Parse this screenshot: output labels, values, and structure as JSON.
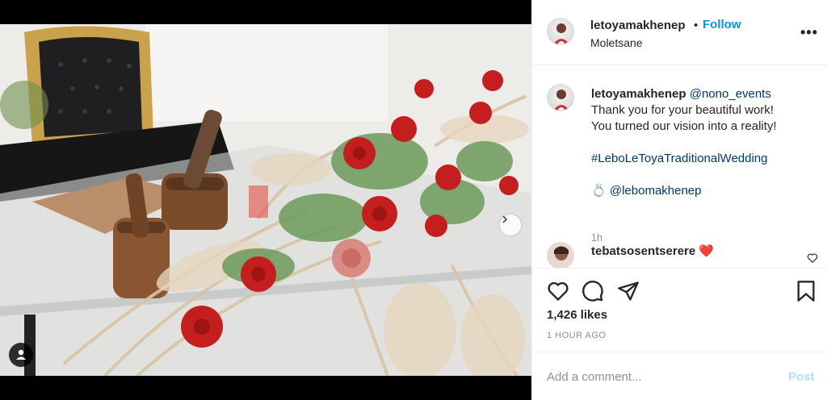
{
  "post": {
    "username": "letoyamakhenep",
    "follow_label": "Follow",
    "separator": "•",
    "location": "Moletsane",
    "more_label": "•••"
  },
  "caption": {
    "username": "letoyamakhenep",
    "mention": "@nono_events",
    "line1": "Thank you for your beautiful work!",
    "line2": "You turned our vision into a reality!",
    "hashtag": "#LeboLeToyaTraditionalWedding",
    "ring_emoji": "💍",
    "tag_user": "@lebomakhenep",
    "time": "1h"
  },
  "comment": {
    "username": "tebatsosentserere",
    "emoji": "❤️"
  },
  "stats": {
    "likes": "1,426 likes",
    "posted": "1 HOUR AGO"
  },
  "comment_box": {
    "placeholder": "Add a comment...",
    "post_label": "Post"
  },
  "icons": [
    "heart-icon",
    "comment-icon",
    "share-icon",
    "bookmark-icon",
    "next-arrow-icon",
    "user-tag-icon",
    "more-options-icon"
  ],
  "colors": {
    "accent": "#0095f6",
    "link": "#00376b",
    "muted": "#8e8e8e",
    "post_disabled": "#b2dffc"
  }
}
